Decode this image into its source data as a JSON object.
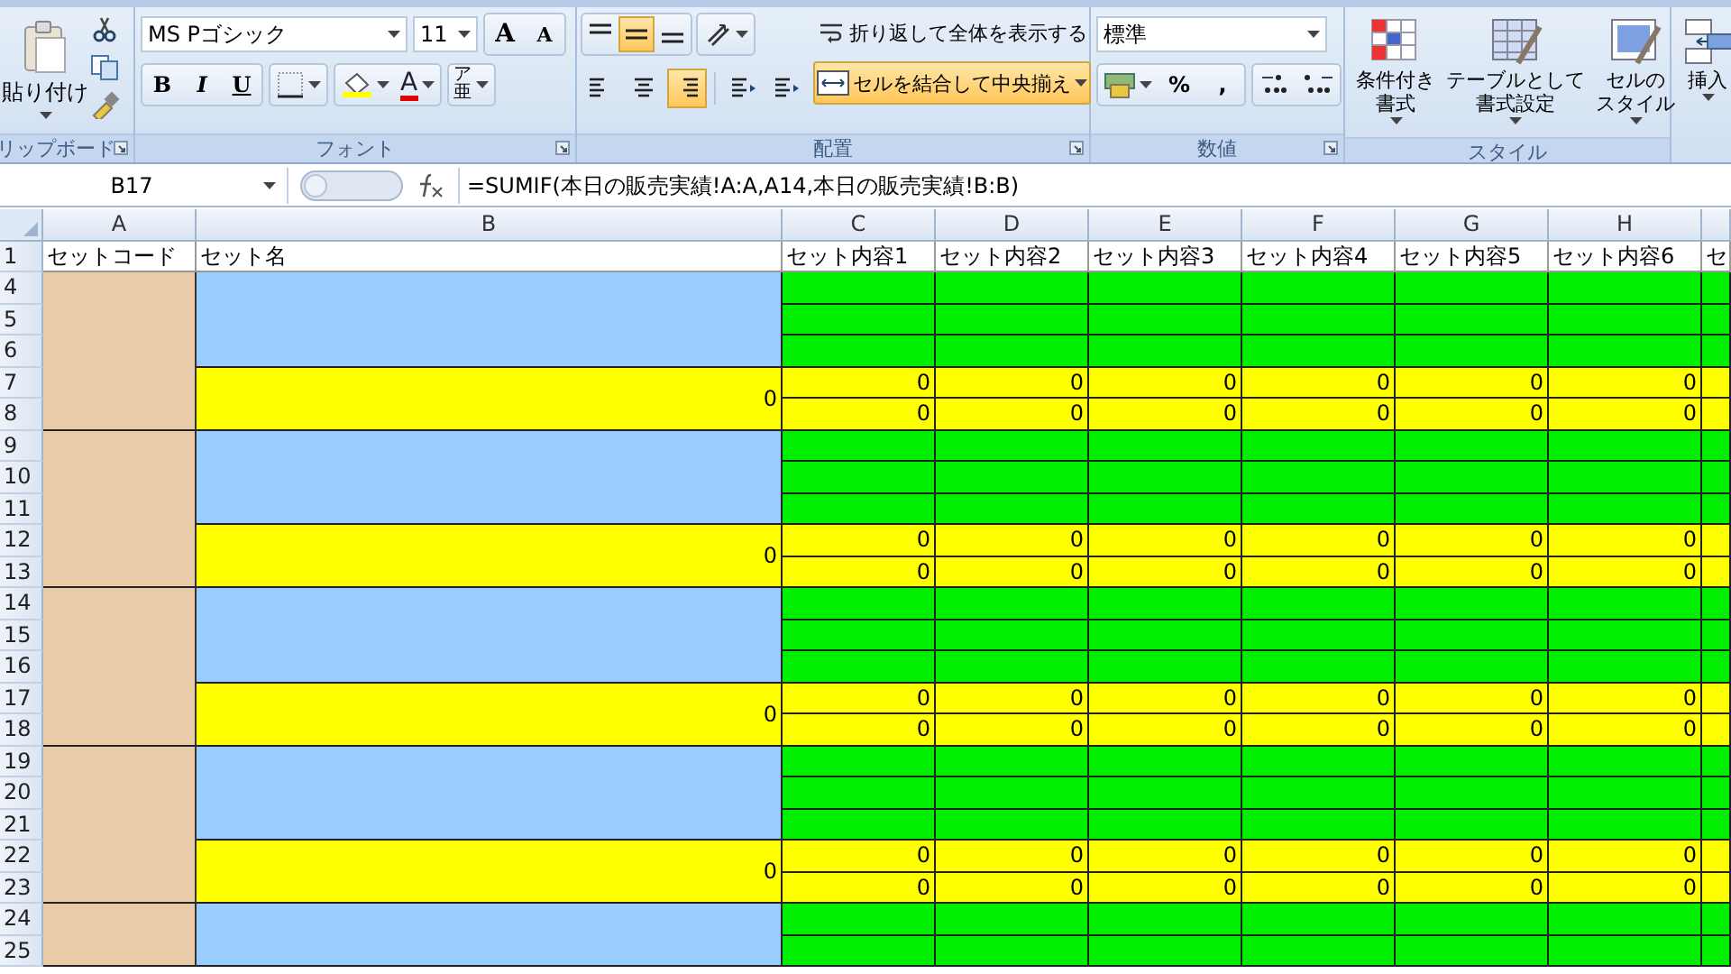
{
  "ribbon": {
    "groups": [
      {
        "kind": "clipboard",
        "label": "リップボード",
        "paste": "貼り付け"
      },
      {
        "kind": "font",
        "label": "フォント",
        "font_name": "MS Pゴシック",
        "font_size": "11",
        "grow": "A",
        "shrink": "A",
        "bold": "B",
        "italic": "I",
        "underline": "U",
        "font_color": "A",
        "phonetic": [
          "ア",
          "亜"
        ]
      },
      {
        "kind": "alignment",
        "label": "配置",
        "vertical": [
          {
            "selected": false
          },
          {
            "selected": true
          },
          {
            "selected": false
          }
        ],
        "horizontal": [
          {
            "selected": false
          },
          {
            "selected": false
          },
          {
            "selected": true
          }
        ],
        "wrap": "折り返して全体を表示する",
        "merge": {
          "label": "セルを結合して中央揃え",
          "selected": true
        }
      },
      {
        "kind": "number",
        "label": "数値",
        "format": "標準",
        "percent": "%",
        "comma": ","
      },
      {
        "kind": "styles",
        "label": "スタイル",
        "buttons": [
          {
            "lines": [
              "条件付き",
              "書式"
            ]
          },
          {
            "lines": [
              "テーブルとして",
              "書式設定"
            ]
          },
          {
            "lines": [
              "セルの",
              "スタイル"
            ]
          }
        ]
      },
      {
        "kind": "cells",
        "buttons": [
          "挿入"
        ]
      }
    ]
  },
  "formula_bar": {
    "name_box": "B17",
    "formula": "=SUMIF(本日の販売実績!A:A,A14,本日の販売実績!B:B)"
  },
  "sheet": {
    "column_headers": [
      "A",
      "B",
      "C",
      "D",
      "E",
      "F",
      "G",
      "H"
    ],
    "header_row": {
      "number": "1",
      "cells": [
        "セットコード",
        "セット名",
        "セット内容1",
        "セット内容2",
        "セット内容3",
        "セット内容4",
        "セット内容5",
        "セット内容6",
        "セ"
      ]
    },
    "groups": [
      {
        "row_numbers": [
          "4",
          "5",
          "6",
          "7",
          "8"
        ],
        "total": "0",
        "values": [
          [
            "0",
            "0",
            "0",
            "0",
            "0",
            "0"
          ],
          [
            "0",
            "0",
            "0",
            "0",
            "0",
            "0"
          ]
        ]
      },
      {
        "row_numbers": [
          "9",
          "10",
          "11",
          "12",
          "13"
        ],
        "total": "0",
        "values": [
          [
            "0",
            "0",
            "0",
            "0",
            "0",
            "0"
          ],
          [
            "0",
            "0",
            "0",
            "0",
            "0",
            "0"
          ]
        ]
      },
      {
        "row_numbers": [
          "14",
          "15",
          "16",
          "17",
          "18"
        ],
        "total": "0",
        "values": [
          [
            "0",
            "0",
            "0",
            "0",
            "0",
            "0"
          ],
          [
            "0",
            "0",
            "0",
            "0",
            "0",
            "0"
          ]
        ]
      },
      {
        "row_numbers": [
          "19",
          "20",
          "21",
          "22",
          "23"
        ],
        "total": "0",
        "values": [
          [
            "0",
            "0",
            "0",
            "0",
            "0",
            "0"
          ],
          [
            "0",
            "0",
            "0",
            "0",
            "0",
            "0"
          ]
        ]
      },
      {
        "row_numbers": [
          "24",
          "25"
        ]
      }
    ]
  }
}
